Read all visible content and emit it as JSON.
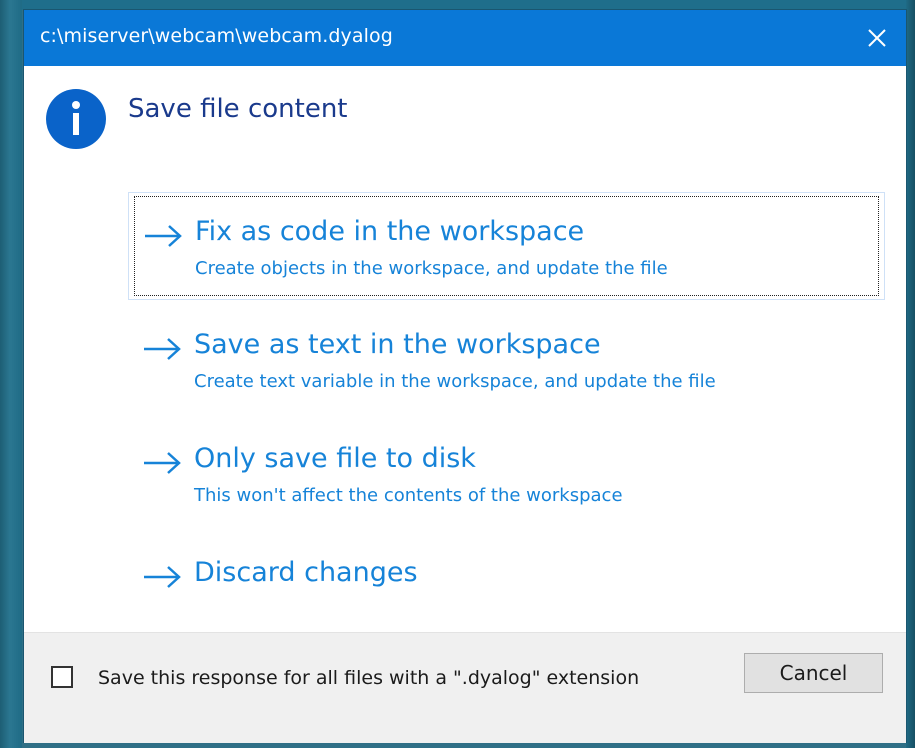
{
  "window": {
    "title": "c:\\miserver\\webcam\\webcam.dyalog",
    "close_icon": "close-icon",
    "accent_color": "#0a78d7"
  },
  "main": {
    "heading": "Save file content",
    "info_icon": "info-icon",
    "link_color": "#1683d8",
    "options": [
      {
        "title": "Fix as code in the workspace",
        "description": "Create objects in the workspace, and update the file",
        "focused": true
      },
      {
        "title": "Save as text in the workspace",
        "description": "Create text variable in the workspace, and update the file",
        "focused": false
      },
      {
        "title": "Only save file to disk",
        "description": "This won't affect the contents of the workspace",
        "focused": false
      },
      {
        "title": "Discard changes",
        "description": "",
        "focused": false
      }
    ]
  },
  "footer": {
    "checkbox_checked": false,
    "checkbox_label": "Save this response for all files with a \".dyalog\" extension",
    "cancel_label": "Cancel"
  }
}
